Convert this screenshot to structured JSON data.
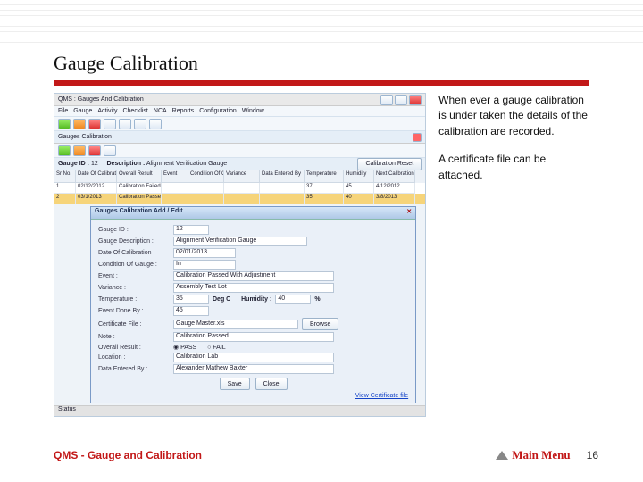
{
  "slide": {
    "title": "Gauge Calibration",
    "body_p1": "When ever a gauge calibration is under taken the details of the calibration are recorded.",
    "body_p2": "A certificate file can be attached.",
    "footer_module": "QMS - Gauge and Calibration",
    "main_menu": "Main Menu",
    "page_number": "16"
  },
  "app": {
    "window_title": "QMS : Gauges And Calibration",
    "menus": [
      "File",
      "Gauge",
      "Activity",
      "Checklist",
      "NCA",
      "Reports",
      "Configuration",
      "Window"
    ],
    "tab_title": "Gauges Calibration",
    "subheader": {
      "gauge_id_label": "Gauge ID :",
      "gauge_id_value": "12",
      "desc_label": "Description :",
      "desc_value": "Alignment Verification Gauge",
      "calreset_btn": "Calibration Reset"
    },
    "grid": {
      "headers": [
        "Sr No.",
        "Date Of Calibration",
        "Overall Result",
        "Event",
        "Condition Of Gauge",
        "Variance",
        "Data Entered By",
        "Temperature",
        "Humidity",
        "Next Calibration Date"
      ],
      "widths": [
        24,
        46,
        50,
        30,
        40,
        40,
        50,
        44,
        34,
        46
      ],
      "rows": [
        [
          "1",
          "02/12/2012",
          "Calibration Failed",
          "",
          "",
          "",
          "",
          "37",
          "45",
          "4/12/2012"
        ],
        [
          "2",
          "03/1/2013",
          "Calibration Passed",
          "",
          "",
          "",
          "",
          "35",
          "40",
          "3/8/2013"
        ]
      ]
    },
    "dialog": {
      "title": "Gauges Calibration  Add / Edit",
      "field_gauge_id": "Gauge ID :",
      "val_gauge_id": "12",
      "field_desc": "Gauge Description :",
      "val_desc": "Alignment Verification Gauge",
      "field_date": "Date Of Calibration :",
      "val_date": "02/01/2013",
      "field_cond": "Condition Of Gauge :",
      "val_cond": "In",
      "field_event": "Event :",
      "val_event": "Calibration Passed With Adjustment",
      "field_variance": "Variance :",
      "val_variance": "Assembly Test Lot",
      "field_temp": "Temperature :",
      "val_temp": "35",
      "lbl_degc": "Deg C",
      "field_hum": "Humidity :",
      "val_hum": "40",
      "lbl_pct": "%",
      "field_eby": "Event Done By :",
      "val_eby": "45",
      "field_cert": "Certificate File :",
      "val_cert": "Gauge Master.xls",
      "btn_browse": "Browse",
      "field_note": "Note :",
      "val_note": "Calibration Passed",
      "field_res": "Overall Result :",
      "opt_pass": "PASS",
      "opt_fail": "FAIL",
      "field_loc": "Location :",
      "val_loc": "Calibration Lab",
      "field_deby": "Data Entered By :",
      "val_deby": "Alexander Mathew Baxter",
      "btn_save": "Save",
      "btn_close": "Close",
      "link_view_cert": "View Certificate file"
    },
    "statusbar": "Status"
  }
}
